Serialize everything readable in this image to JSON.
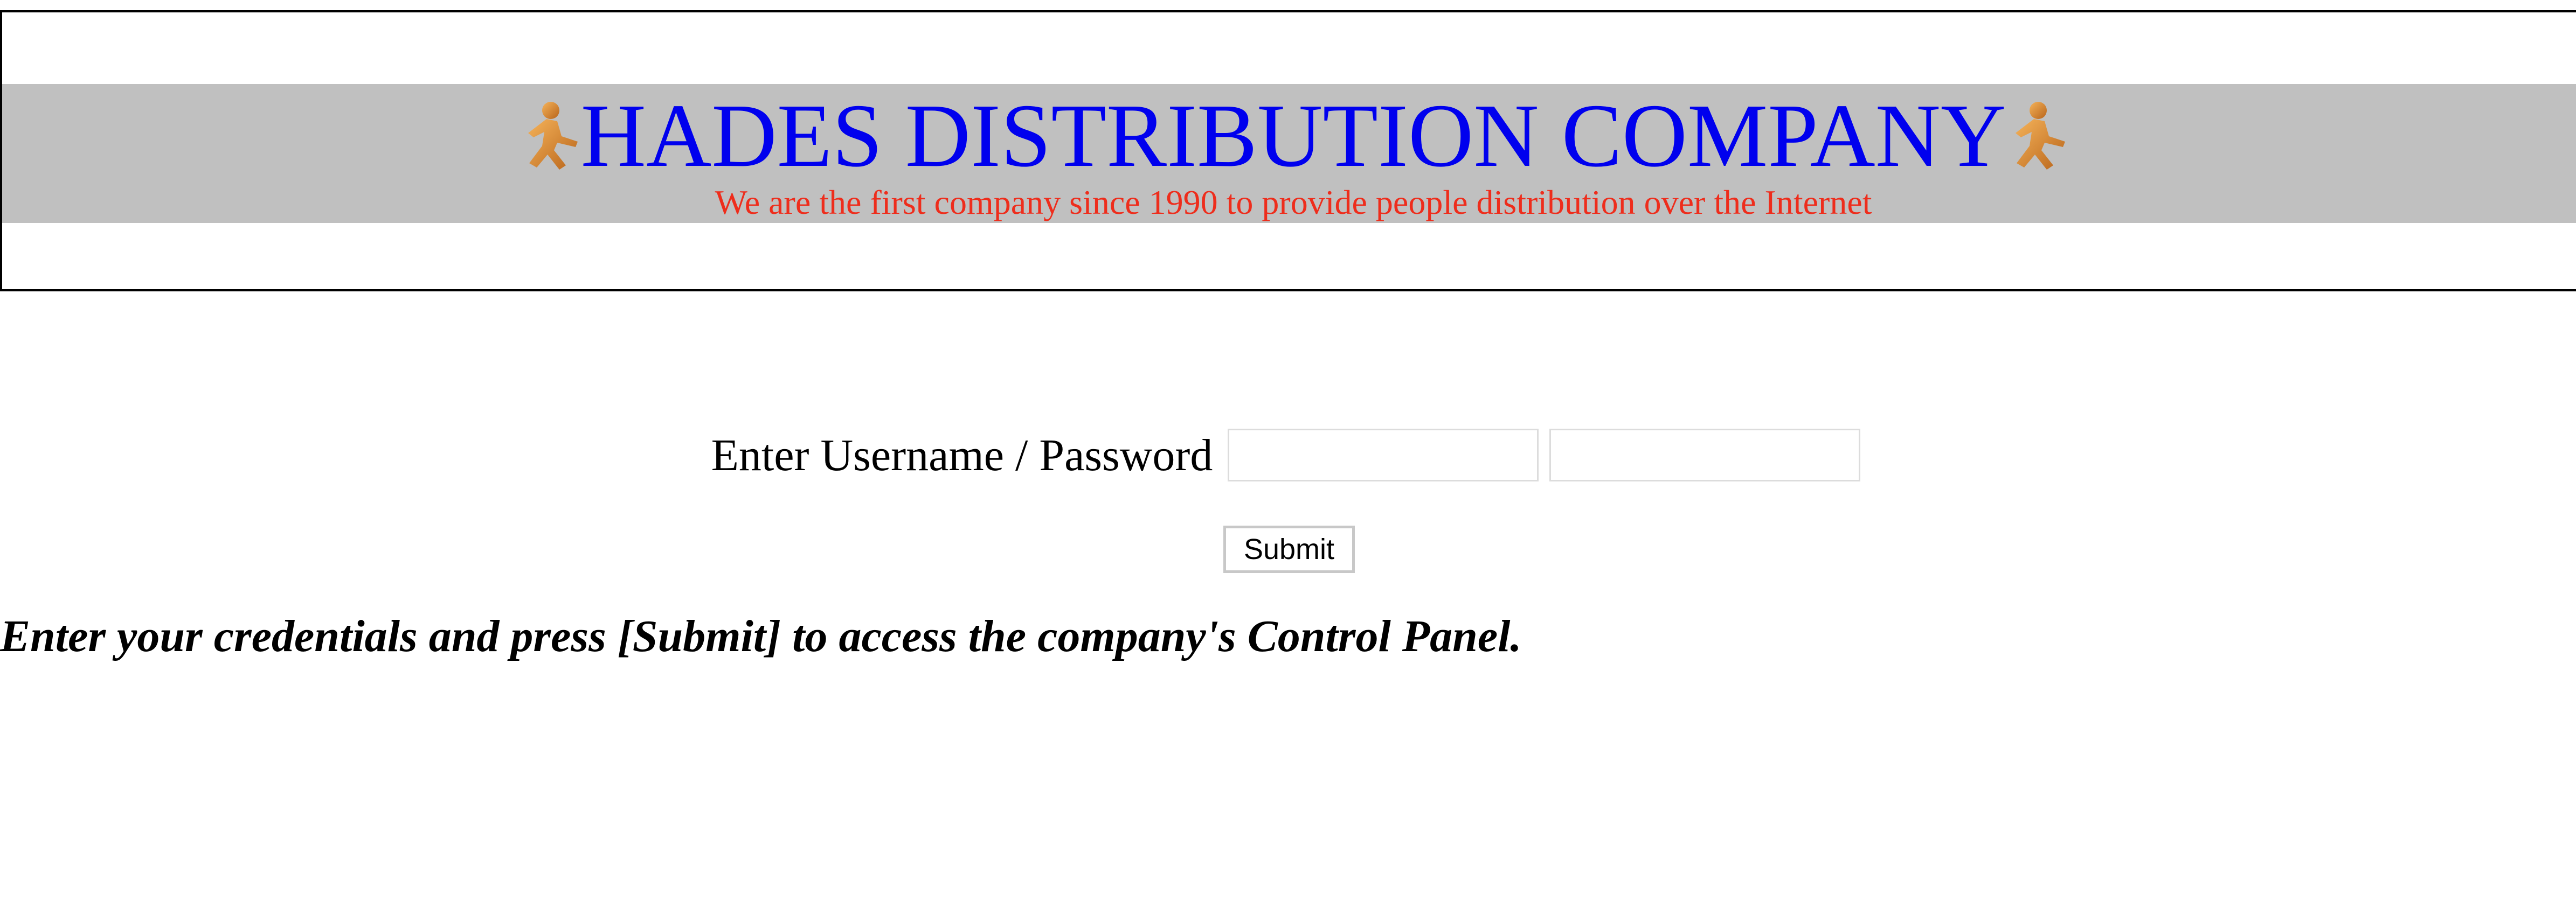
{
  "header": {
    "title": "HADES DISTRIBUTION COMPANY",
    "tagline": "We are the first company since 1990 to provide people distribution over the Internet",
    "icon_left": "running-man-icon",
    "icon_right": "running-man-icon"
  },
  "login": {
    "label": "Enter Username / Password",
    "username_value": "",
    "password_value": "",
    "submit_label": "Submit"
  },
  "instructions": "Enter your credentials and press [Submit] to access the company's Control Panel.",
  "colors": {
    "title": "#0000ee",
    "tagline": "#ee2d1c",
    "band": "#c0c0c0",
    "icon": "#e08a2a"
  }
}
